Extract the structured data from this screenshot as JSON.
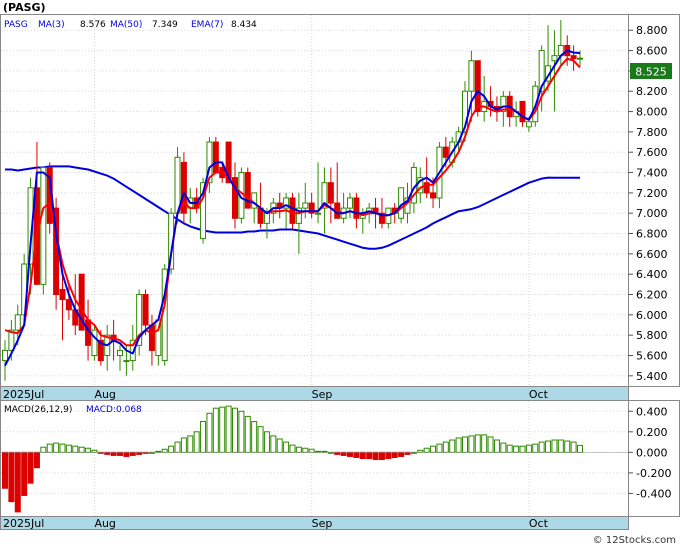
{
  "header": {
    "symbol_label": "(PASG)",
    "ticker": "PASG",
    "ma3_label": "MA(3)",
    "ma3_value": "8.576",
    "ma50_label": "MA(50)",
    "ma50_value": "7.349",
    "ema7_label": "EMA(7)",
    "ema7_value": "8.434"
  },
  "macd_header": {
    "label": "MACD(26,12,9)",
    "value_label": "MACD:0.068"
  },
  "watermark": "© 12Stocks.com",
  "colors": {
    "up": "#2e8b00",
    "down": "#dd0000",
    "ma_fast": "#0000dd",
    "ma_slow": "#0000dd",
    "ema": "#ff0000",
    "ma50": "#0000dd",
    "axis_band": "#add8e6",
    "price_badge": "#1a7a1a"
  },
  "chart_data": [
    {
      "type": "candlestick",
      "title": "(PASG)",
      "last_price_label": "8.525",
      "ylim": [
        5.3,
        8.95
      ],
      "y_ticks": [
        "8.800",
        "8.600",
        "8.400",
        "8.200",
        "8.000",
        "7.800",
        "7.600",
        "7.400",
        "7.200",
        "7.000",
        "6.800",
        "6.600",
        "6.400",
        "6.200",
        "6.000",
        "5.800",
        "5.600",
        "5.400"
      ],
      "x_ticks": [
        {
          "label": "2025Jul",
          "index": 0
        },
        {
          "label": "Aug",
          "index": 14
        },
        {
          "label": "Sep",
          "index": 48
        },
        {
          "label": "Oct",
          "index": 82
        }
      ],
      "ohlc": [
        [
          5.55,
          5.75,
          5.35,
          5.65
        ],
        [
          5.65,
          5.95,
          5.55,
          5.85
        ],
        [
          5.85,
          6.1,
          5.7,
          6.0
        ],
        [
          6.0,
          6.6,
          5.9,
          6.5
        ],
        [
          6.5,
          7.35,
          6.2,
          7.25
        ],
        [
          7.25,
          7.7,
          6.4,
          6.3
        ],
        [
          6.3,
          7.45,
          6.2,
          7.45
        ],
        [
          7.45,
          7.5,
          6.8,
          6.9
        ],
        [
          7.05,
          7.15,
          6.05,
          6.2
        ],
        [
          6.25,
          6.4,
          5.75,
          6.15
        ],
        [
          6.15,
          6.3,
          5.95,
          6.05
        ],
        [
          6.05,
          6.4,
          5.8,
          5.9
        ],
        [
          6.4,
          6.4,
          5.85,
          5.85
        ],
        [
          5.95,
          6.15,
          5.55,
          5.7
        ],
        [
          5.6,
          5.9,
          5.55,
          5.85
        ],
        [
          5.75,
          5.85,
          5.5,
          5.55
        ],
        [
          5.6,
          5.9,
          5.45,
          5.8
        ],
        [
          5.8,
          5.95,
          5.55,
          5.75
        ],
        [
          5.6,
          5.7,
          5.45,
          5.65
        ],
        [
          5.55,
          5.7,
          5.4,
          5.55
        ],
        [
          5.55,
          5.9,
          5.45,
          5.75
        ],
        [
          5.7,
          6.25,
          5.6,
          6.2
        ],
        [
          6.2,
          6.25,
          5.8,
          5.9
        ],
        [
          5.9,
          6.0,
          5.5,
          5.65
        ],
        [
          5.6,
          5.95,
          5.5,
          5.95
        ],
        [
          5.55,
          6.5,
          5.5,
          6.45
        ],
        [
          6.45,
          7.05,
          6.4,
          7.0
        ],
        [
          7.0,
          7.65,
          6.9,
          7.55
        ],
        [
          7.5,
          7.6,
          6.9,
          7.0
        ],
        [
          7.05,
          7.25,
          6.9,
          7.15
        ],
        [
          7.15,
          7.25,
          7.0,
          7.05
        ],
        [
          6.75,
          7.35,
          6.7,
          7.3
        ],
        [
          7.3,
          7.75,
          7.2,
          7.7
        ],
        [
          7.7,
          7.75,
          7.4,
          7.4
        ],
        [
          7.45,
          7.5,
          7.3,
          7.35
        ],
        [
          7.7,
          7.7,
          7.3,
          7.3
        ],
        [
          7.35,
          7.5,
          6.85,
          6.95
        ],
        [
          6.95,
          7.45,
          6.9,
          7.4
        ],
        [
          7.4,
          7.45,
          7.05,
          7.05
        ],
        [
          7.05,
          7.2,
          6.9,
          7.2
        ],
        [
          7.05,
          7.3,
          6.85,
          6.9
        ],
        [
          6.9,
          7.05,
          6.75,
          7.0
        ],
        [
          7.0,
          7.15,
          6.9,
          7.1
        ],
        [
          7.1,
          7.2,
          6.95,
          7.05
        ],
        [
          7.05,
          7.2,
          6.85,
          7.15
        ],
        [
          7.15,
          7.2,
          6.85,
          6.9
        ],
        [
          6.9,
          7.2,
          6.6,
          7.05
        ],
        [
          7.05,
          7.3,
          6.95,
          7.1
        ],
        [
          7.1,
          7.2,
          6.95,
          7.0
        ],
        [
          7.0,
          7.5,
          6.9,
          7.0
        ],
        [
          7.05,
          7.45,
          6.8,
          7.3
        ],
        [
          7.3,
          7.45,
          6.9,
          7.1
        ],
        [
          7.1,
          7.5,
          6.95,
          6.95
        ],
        [
          6.95,
          7.2,
          6.9,
          7.05
        ],
        [
          7.05,
          7.2,
          6.95,
          7.15
        ],
        [
          7.15,
          7.2,
          6.85,
          6.95
        ],
        [
          6.95,
          7.05,
          6.8,
          7.0
        ],
        [
          7.0,
          7.1,
          6.9,
          7.05
        ],
        [
          7.05,
          7.15,
          6.85,
          7.0
        ],
        [
          7.0,
          7.15,
          6.85,
          6.9
        ],
        [
          6.9,
          7.05,
          6.85,
          7.05
        ],
        [
          7.05,
          7.1,
          6.9,
          7.0
        ],
        [
          6.95,
          7.25,
          6.9,
          7.25
        ],
        [
          7.0,
          7.3,
          6.9,
          7.15
        ],
        [
          7.1,
          7.5,
          7.0,
          7.45
        ],
        [
          7.2,
          7.45,
          7.1,
          7.35
        ],
        [
          7.3,
          7.55,
          7.15,
          7.2
        ],
        [
          7.2,
          7.35,
          7.05,
          7.15
        ],
        [
          7.15,
          7.7,
          7.05,
          7.65
        ],
        [
          7.65,
          7.75,
          7.45,
          7.55
        ],
        [
          7.5,
          7.75,
          7.45,
          7.7
        ],
        [
          7.7,
          7.85,
          7.6,
          7.8
        ],
        [
          7.8,
          8.3,
          7.7,
          8.2
        ],
        [
          8.2,
          8.6,
          7.9,
          8.5
        ],
        [
          8.5,
          8.45,
          7.95,
          8.0
        ],
        [
          8.0,
          8.35,
          7.9,
          8.1
        ],
        [
          8.1,
          8.25,
          7.95,
          8.05
        ],
        [
          8.05,
          8.15,
          7.9,
          8.0
        ],
        [
          8.0,
          8.2,
          7.85,
          8.15
        ],
        [
          8.15,
          8.2,
          7.85,
          7.95
        ],
        [
          7.95,
          8.1,
          7.85,
          8.0
        ],
        [
          8.1,
          8.1,
          7.85,
          7.9
        ],
        [
          7.85,
          7.95,
          7.8,
          7.9
        ],
        [
          7.9,
          8.3,
          7.85,
          8.25
        ],
        [
          8.2,
          8.65,
          8.0,
          8.6
        ],
        [
          8.3,
          8.85,
          8.2,
          8.45
        ],
        [
          8.5,
          8.8,
          8.0,
          8.55
        ],
        [
          8.55,
          8.9,
          8.45,
          8.65
        ],
        [
          8.65,
          8.75,
          8.45,
          8.55
        ],
        [
          8.55,
          8.65,
          8.4,
          8.52
        ],
        [
          8.52,
          8.6,
          8.45,
          8.525
        ]
      ],
      "series": [
        {
          "name": "MA(3)",
          "values": [
            5.5,
            5.62,
            5.75,
            5.9,
            6.7,
            7.4,
            7.4,
            7.35,
            6.8,
            6.4,
            6.2,
            6.05,
            5.95,
            5.85,
            5.78,
            5.72,
            5.7,
            5.75,
            5.72,
            5.65,
            5.62,
            5.78,
            5.85,
            5.9,
            5.95,
            6.2,
            6.6,
            7.0,
            7.2,
            7.1,
            7.1,
            7.2,
            7.45,
            7.5,
            7.5,
            7.35,
            7.25,
            7.15,
            7.12,
            7.1,
            7.05,
            7.0,
            7.05,
            7.05,
            7.08,
            7.05,
            7.02,
            7.02,
            7.02,
            7.02,
            7.1,
            7.05,
            7.0,
            7.0,
            7.02,
            7.0,
            7.0,
            7.02,
            7.0,
            6.98,
            6.98,
            7.0,
            7.08,
            7.12,
            7.25,
            7.32,
            7.35,
            7.3,
            7.4,
            7.5,
            7.6,
            7.7,
            7.85,
            8.1,
            8.2,
            8.15,
            8.05,
            8.02,
            8.05,
            8.05,
            8.0,
            7.95,
            7.92,
            8.05,
            8.25,
            8.35,
            8.45,
            8.55,
            8.6,
            8.58,
            8.576
          ]
        },
        {
          "name": "EMA(7)",
          "values": [
            5.85,
            5.83,
            5.82,
            5.9,
            6.3,
            6.8,
            7.05,
            7.1,
            6.8,
            6.5,
            6.3,
            6.15,
            6.05,
            5.95,
            5.9,
            5.8,
            5.78,
            5.77,
            5.75,
            5.7,
            5.7,
            5.8,
            5.85,
            5.82,
            5.85,
            6.1,
            6.6,
            7.0,
            7.1,
            7.05,
            7.05,
            7.15,
            7.35,
            7.4,
            7.4,
            7.35,
            7.25,
            7.2,
            7.15,
            7.1,
            7.05,
            7.0,
            7.02,
            7.02,
            7.03,
            7.0,
            7.0,
            7.02,
            7.02,
            7.02,
            7.08,
            7.05,
            7.02,
            7.0,
            7.02,
            7.0,
            6.98,
            7.0,
            7.0,
            6.98,
            6.98,
            7.0,
            7.05,
            7.1,
            7.18,
            7.25,
            7.28,
            7.28,
            7.35,
            7.42,
            7.5,
            7.6,
            7.75,
            7.95,
            8.05,
            8.05,
            8.02,
            8.0,
            8.02,
            8.02,
            8.0,
            7.95,
            7.92,
            8.0,
            8.15,
            8.25,
            8.35,
            8.45,
            8.52,
            8.5,
            8.434
          ]
        },
        {
          "name": "MA(50)",
          "values": [
            7.43,
            7.43,
            7.42,
            7.43,
            7.44,
            7.45,
            7.45,
            7.46,
            7.46,
            7.46,
            7.46,
            7.45,
            7.44,
            7.43,
            7.41,
            7.39,
            7.37,
            7.34,
            7.3,
            7.26,
            7.22,
            7.18,
            7.14,
            7.1,
            7.06,
            7.02,
            6.98,
            6.94,
            6.9,
            6.87,
            6.85,
            6.83,
            6.82,
            6.81,
            6.81,
            6.81,
            6.81,
            6.81,
            6.82,
            6.82,
            6.83,
            6.83,
            6.83,
            6.84,
            6.84,
            6.84,
            6.83,
            6.82,
            6.81,
            6.8,
            6.78,
            6.76,
            6.74,
            6.72,
            6.7,
            6.68,
            6.66,
            6.65,
            6.65,
            6.66,
            6.68,
            6.71,
            6.74,
            6.77,
            6.8,
            6.83,
            6.86,
            6.9,
            6.93,
            6.96,
            6.99,
            7.02,
            7.03,
            7.04,
            7.06,
            7.09,
            7.12,
            7.15,
            7.18,
            7.21,
            7.24,
            7.27,
            7.3,
            7.32,
            7.34,
            7.35,
            7.349,
            7.349,
            7.349,
            7.349,
            7.349
          ]
        }
      ]
    },
    {
      "type": "bar",
      "title": "MACD(26,12,9)",
      "ylim": [
        -0.62,
        0.5
      ],
      "y_ticks": [
        "0.400",
        "0.200",
        "0.000",
        "-0.200",
        "-0.400"
      ],
      "values": [
        -0.35,
        -0.48,
        -0.58,
        -0.42,
        -0.3,
        -0.15,
        0.05,
        0.08,
        0.09,
        0.08,
        0.07,
        0.06,
        0.05,
        0.04,
        0.02,
        -0.01,
        -0.02,
        -0.03,
        -0.03,
        -0.04,
        -0.03,
        -0.02,
        -0.01,
        0.0,
        0.01,
        0.03,
        0.06,
        0.1,
        0.14,
        0.16,
        0.2,
        0.3,
        0.38,
        0.43,
        0.44,
        0.45,
        0.43,
        0.4,
        0.35,
        0.3,
        0.25,
        0.2,
        0.16,
        0.13,
        0.1,
        0.07,
        0.05,
        0.04,
        0.03,
        0.01,
        0.01,
        0.0,
        -0.02,
        -0.03,
        -0.04,
        -0.05,
        -0.06,
        -0.06,
        -0.07,
        -0.07,
        -0.06,
        -0.05,
        -0.04,
        -0.02,
        0.0,
        0.02,
        0.04,
        0.06,
        0.08,
        0.1,
        0.12,
        0.14,
        0.15,
        0.16,
        0.17,
        0.17,
        0.15,
        0.12,
        0.09,
        0.07,
        0.06,
        0.06,
        0.07,
        0.08,
        0.1,
        0.11,
        0.12,
        0.12,
        0.11,
        0.1,
        0.068
      ]
    }
  ]
}
